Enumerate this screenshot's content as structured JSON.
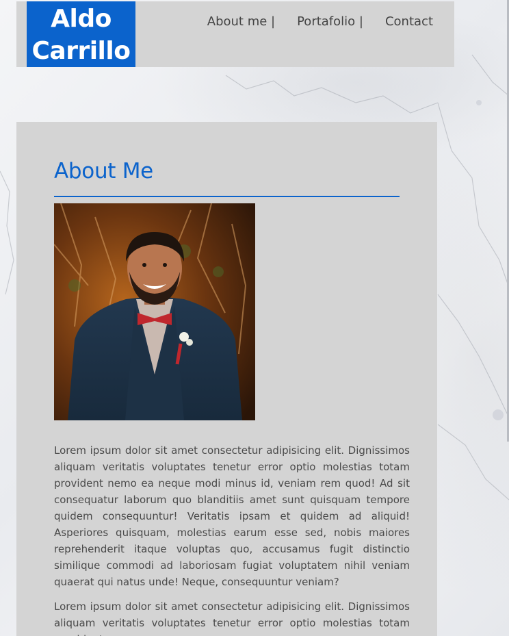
{
  "header": {
    "logo_line1": "Aldo",
    "logo_line2": "Carrillo",
    "nav": [
      {
        "label": "About me |"
      },
      {
        "label": "Portafolio |"
      },
      {
        "label": "Contact"
      }
    ]
  },
  "main": {
    "title": "About Me",
    "paragraphs": [
      "Lorem ipsum dolor sit amet consectetur adipisicing elit. Dignissimos aliquam veritatis voluptates tenetur error optio molestias totam provident nemo ea neque modi minus id, veniam rem quod! Ad sit consequatur laborum quo blanditiis amet sunt quisquam tempore quidem consequuntur! Veritatis ipsam et quidem ad aliquid! Asperiores quisquam, molestias earum esse sed, nobis maiores reprehenderit itaque voluptas quo, accusamus fugit distinctio similique commodi ad laboriosam fugiat voluptatem nihil veniam quaerat qui natus unde! Neque, consequuntur veniam?",
      "Lorem ipsum dolor sit amet consectetur adipisicing elit. Dignissimos aliquam veritatis voluptates tenetur error optio molestias totam provident"
    ]
  },
  "colors": {
    "accent": "#0b63cc",
    "panel": "#d4d4d4",
    "text": "#4a4a4a"
  }
}
